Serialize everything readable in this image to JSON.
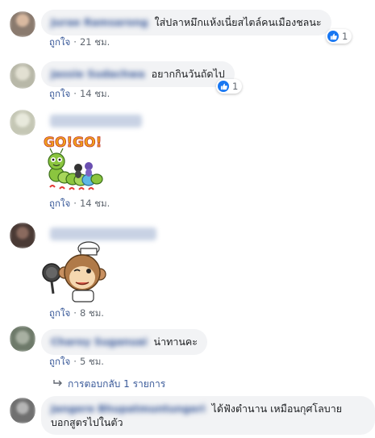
{
  "comments": [
    {
      "name": "Jurae Ramsarong",
      "text": "ใส่ปลาหมึกแห้งเนี่ยสไตล์คนเมืองชลนะ",
      "like_label": "ถูกใจ",
      "time": "21 ชม.",
      "reactions": "1",
      "avatar_color": "#8a7a6e"
    },
    {
      "name": "Jassie Sudachwa",
      "text": "อยากกินวันถัดไป",
      "like_label": "ถูกใจ",
      "time": "14 ชม.",
      "reactions": "1",
      "avatar_color": "#b8b8a8"
    },
    {
      "name": "Jassie Sudachwa",
      "like_label": "ถูกใจ",
      "time": "14 ชม.",
      "sticker_text": "GO!GO!",
      "avatar_color": "#c5c7b5"
    },
    {
      "name": "Prinnnat Buranrak",
      "like_label": "ถูกใจ",
      "time": "8 ชม.",
      "avatar_color": "#4a3a35"
    },
    {
      "name": "Charoy Suganuai",
      "text": "น่าทานคะ",
      "like_label": "ถูกใจ",
      "time": "5 ชม.",
      "reply_link": "การตอบกลับ 1 รายการ",
      "avatar_color": "#6e7a6a"
    },
    {
      "name": "Jangere Bhupatmuntungeri",
      "text_line1": "ได้ฟังตำนาน เหมือนกุศโลบาย",
      "text_line2": "บอกสูตรไปในตัว",
      "avatar_color": "#707070"
    }
  ],
  "colors": {
    "link": "#385898",
    "bubble": "#f2f3f5",
    "meta": "#606770",
    "like_blue": "#1877f2"
  }
}
